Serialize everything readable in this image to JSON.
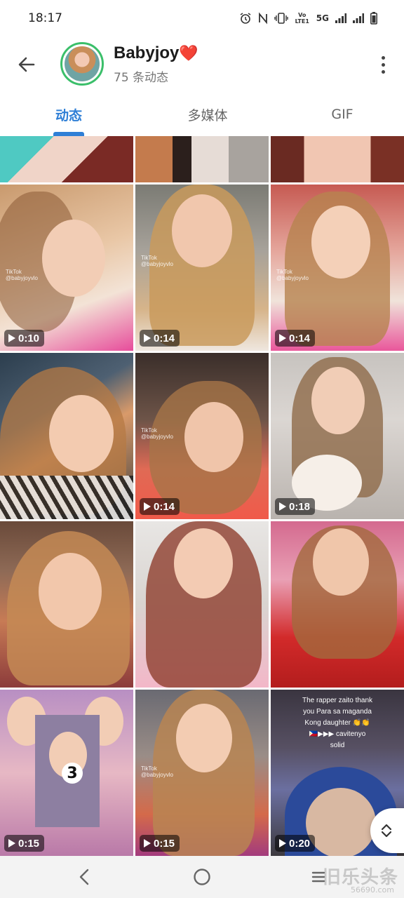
{
  "status_bar": {
    "time": "18:17",
    "network_label": "5G",
    "volte_label": "Vo LTE1"
  },
  "header": {
    "name": "Babyjoy",
    "heart": "❤️",
    "subtitle": "75 条动态"
  },
  "tabs": [
    {
      "label": "动态",
      "active": true
    },
    {
      "label": "多媒体",
      "active": false
    },
    {
      "label": "GIF",
      "active": false
    }
  ],
  "grid": {
    "tiktok_label": "TikTok",
    "tiktok_handle": "@babyjoyvlo",
    "items": [
      {
        "duration": ""
      },
      {
        "duration": ""
      },
      {
        "duration": ""
      },
      {
        "duration": "0:10"
      },
      {
        "duration": "0:14"
      },
      {
        "duration": "0:14"
      },
      {
        "duration": ""
      },
      {
        "duration": "0:14"
      },
      {
        "duration": "0:18"
      },
      {
        "duration": ""
      },
      {
        "duration": ""
      },
      {
        "duration": ""
      },
      {
        "duration": "0:15"
      },
      {
        "duration": "0:15"
      },
      {
        "duration": "0:20"
      }
    ],
    "story_number": "3",
    "caption_lines": [
      "The rapper zaito thank",
      "you Para sa maganda",
      "Kong daughter 👏👏",
      "🇵🇭▶▶▶ cavitenyo",
      "solid"
    ]
  },
  "watermark": {
    "text": "旧乐头条",
    "sub": "56690.com"
  },
  "colors": {
    "accent": "#2f7fd6",
    "avatar_ring": "#3bbf6a"
  }
}
